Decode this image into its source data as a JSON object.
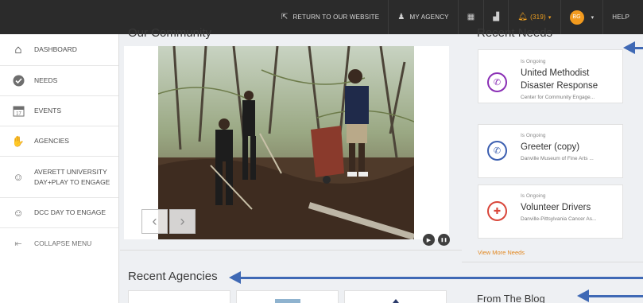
{
  "topbar": {
    "return_label": "RETURN TO OUR WEBSITE",
    "agency_label": "MY AGENCY",
    "notifications": "(319)",
    "avatar_initials": "BG",
    "help_label": "HELP"
  },
  "sidebar": {
    "items": [
      {
        "label": "DASHBOARD",
        "icon": "home-icon"
      },
      {
        "label": "NEEDS",
        "icon": "check-circle-icon"
      },
      {
        "label": "EVENTS",
        "icon": "calendar-icon"
      },
      {
        "label": "AGENCIES",
        "icon": "handshake-icon"
      },
      {
        "label": "AVERETT UNIVERSITY DAY+PLAY TO ENGAGE",
        "icon": "group-icon"
      },
      {
        "label": "DCC DAY TO ENGAGE",
        "icon": "group-icon"
      },
      {
        "label": "COLLAPSE MENU",
        "icon": "collapse-icon"
      }
    ]
  },
  "main": {
    "community_title": "Our Community",
    "agencies_title": "Recent Agencies",
    "prev_glyph": "‹",
    "next_glyph": "›",
    "play_glyph": "▶",
    "pause_glyph": "❚❚"
  },
  "right": {
    "needs_title": "Recent Needs",
    "needs": [
      {
        "status": "Is Ongoing",
        "title": "United Methodist Disaster Response",
        "org": "Center for Community Engage...",
        "color": "#8a2fb5",
        "icon": "megaphone-icon"
      },
      {
        "status": "Is Ongoing",
        "title": "Greeter (copy)",
        "org": "Danville Museum of Fine Arts ...",
        "color": "#3c5fb0",
        "icon": "megaphone-icon"
      },
      {
        "status": "Is Ongoing",
        "title": "Volunteer Drivers",
        "org": "Danville-Pittsylvania Cancer As...",
        "color": "#d9463a",
        "icon": "ambulance-icon"
      }
    ],
    "view_more": "View More Needs",
    "blog_title": "From The Blog"
  },
  "colors": {
    "accent_orange": "#e2871f",
    "arrow_blue": "#3f69b5",
    "topbar": "#2b2b2b"
  }
}
